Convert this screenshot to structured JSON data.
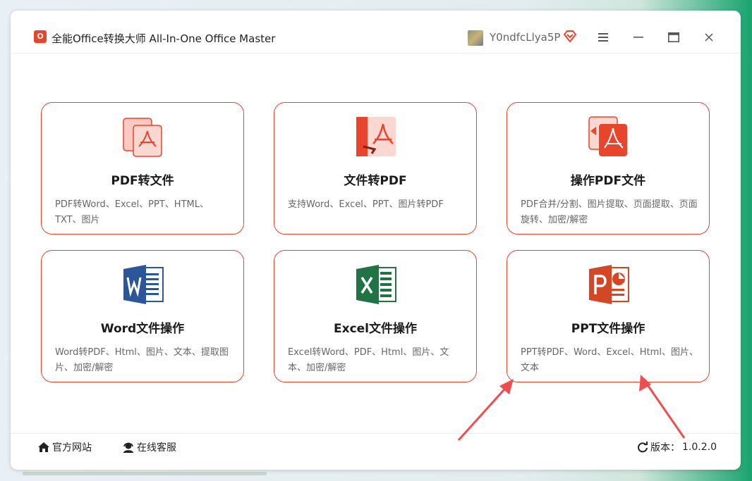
{
  "window": {
    "title": "全能Office转换大师 All-In-One Office Master",
    "logo_text": "O",
    "username": "Y0ndfcLlya5P"
  },
  "cards": [
    {
      "title": "PDF转文件",
      "desc": "PDF转Word、Excel、PPT、HTML、TXT、图片",
      "icon": "pdf-to-file-icon"
    },
    {
      "title": "文件转PDF",
      "desc": "支持Word、Excel、PPT、图片转PDF",
      "icon": "file-to-pdf-icon"
    },
    {
      "title": "操作PDF文件",
      "desc": "PDF合并/分割、图片提取、页面提取、页面旋转、加密/解密",
      "icon": "pdf-operate-icon"
    },
    {
      "title": "Word文件操作",
      "desc": "Word转PDF、Html、图片、文本、提取图片、加密/解密",
      "icon": "word-icon"
    },
    {
      "title": "Excel文件操作",
      "desc": "Excel转Word、PDF、Html、图片、文本、加密/解密",
      "icon": "excel-icon"
    },
    {
      "title": "PPT文件操作",
      "desc": "PPT转PDF、Word、Excel、Html、图片、文本",
      "icon": "ppt-icon"
    }
  ],
  "footer": {
    "website": "官方网站",
    "support": "在线客服",
    "version_label": "版本：",
    "version": "1.0.2.0"
  },
  "colors": {
    "accent": "#e8452c",
    "word": "#2b579a",
    "excel": "#217346",
    "ppt": "#d24726"
  }
}
